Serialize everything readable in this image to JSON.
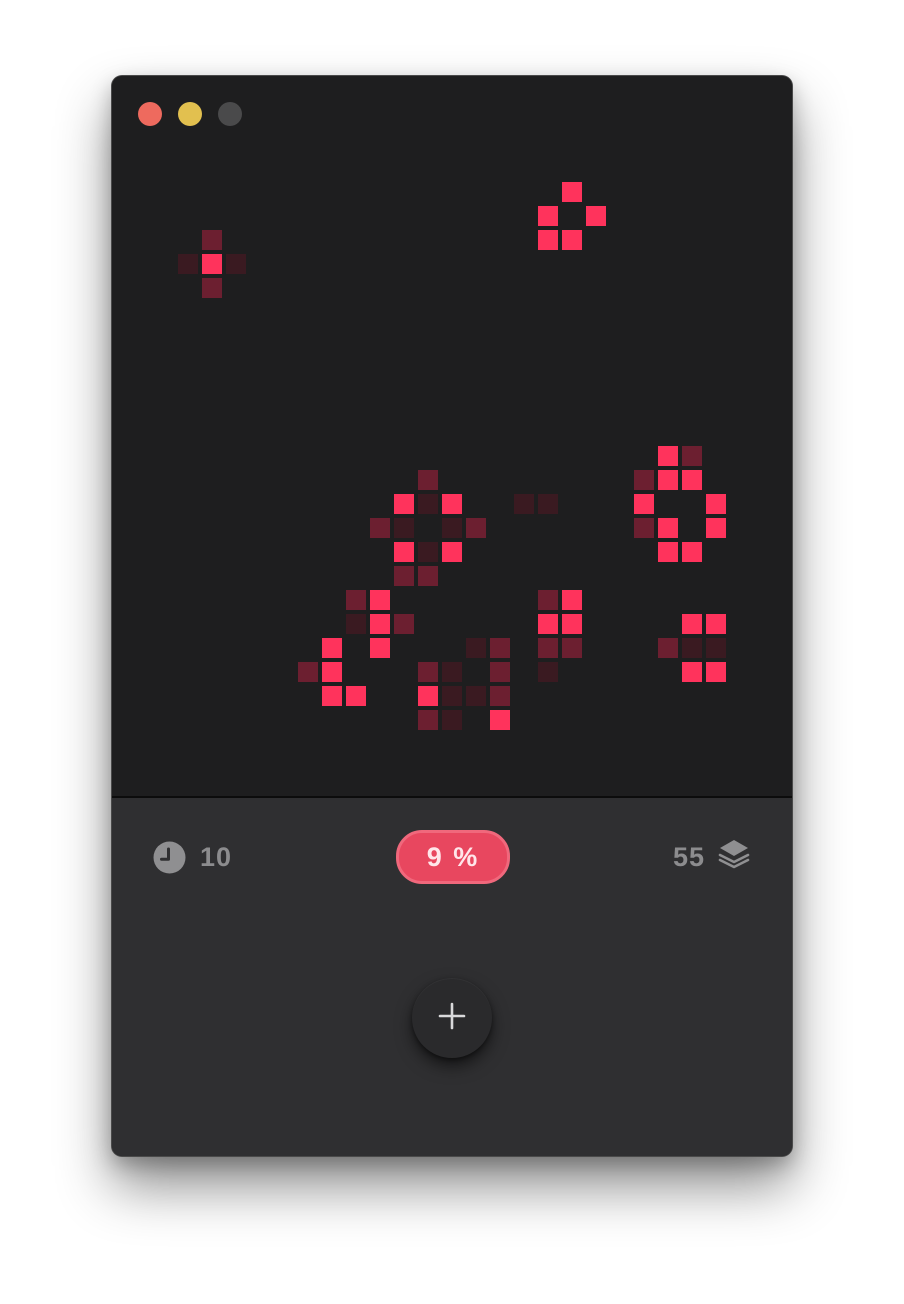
{
  "window": {
    "traffic_lights": [
      {
        "name": "close",
        "color": "#ee6a5e"
      },
      {
        "name": "minimize",
        "color": "#e2c04f"
      },
      {
        "name": "zoom-disabled",
        "color": "#4a4a4b"
      }
    ]
  },
  "board": {
    "cell_colors": {
      "alive": "#ff335c",
      "dying": "#6c1f30",
      "fading": "#3a1a21",
      "background": "#1e1e1f"
    },
    "cells": {
      "alive": [
        [
          19,
          4
        ],
        [
          18,
          5
        ],
        [
          20,
          5
        ],
        [
          18,
          6
        ],
        [
          19,
          6
        ],
        [
          4,
          7
        ],
        [
          23,
          15
        ],
        [
          23,
          16
        ],
        [
          24,
          16
        ],
        [
          12,
          17
        ],
        [
          14,
          17
        ],
        [
          22,
          17
        ],
        [
          25,
          17
        ],
        [
          23,
          18
        ],
        [
          25,
          18
        ],
        [
          12,
          19
        ],
        [
          14,
          19
        ],
        [
          23,
          19
        ],
        [
          24,
          19
        ],
        [
          11,
          21
        ],
        [
          19,
          21
        ],
        [
          11,
          22
        ],
        [
          18,
          22
        ],
        [
          19,
          22
        ],
        [
          24,
          22
        ],
        [
          25,
          22
        ],
        [
          9,
          23
        ],
        [
          11,
          23
        ],
        [
          9,
          24
        ],
        [
          9,
          25
        ],
        [
          10,
          25
        ],
        [
          13,
          25
        ],
        [
          16,
          26
        ],
        [
          24,
          24
        ],
        [
          25,
          24
        ]
      ],
      "dying": [
        [
          4,
          6
        ],
        [
          4,
          8
        ],
        [
          24,
          15
        ],
        [
          13,
          16
        ],
        [
          22,
          16
        ],
        [
          11,
          18
        ],
        [
          15,
          18
        ],
        [
          22,
          18
        ],
        [
          12,
          20
        ],
        [
          13,
          20
        ],
        [
          10,
          21
        ],
        [
          18,
          21
        ],
        [
          12,
          22
        ],
        [
          16,
          23
        ],
        [
          18,
          23
        ],
        [
          19,
          23
        ],
        [
          23,
          23
        ],
        [
          8,
          24
        ],
        [
          13,
          24
        ],
        [
          16,
          24
        ],
        [
          16,
          25
        ],
        [
          13,
          26
        ]
      ],
      "fading": [
        [
          3,
          7
        ],
        [
          5,
          7
        ],
        [
          13,
          17
        ],
        [
          17,
          17
        ],
        [
          18,
          17
        ],
        [
          12,
          18
        ],
        [
          14,
          18
        ],
        [
          13,
          19
        ],
        [
          10,
          22
        ],
        [
          15,
          23
        ],
        [
          14,
          24
        ],
        [
          18,
          24
        ],
        [
          24,
          23
        ],
        [
          25,
          23
        ],
        [
          14,
          25
        ],
        [
          15,
          25
        ],
        [
          14,
          26
        ]
      ]
    }
  },
  "status": {
    "generation_icon": "clock-icon",
    "generation_count": "10",
    "coverage_percent_label": "9 %",
    "coverage_percent": 9,
    "population_count": "55",
    "population_icon": "layers-icon",
    "accent_color": "#e8475f"
  },
  "actions": {
    "add_icon": "plus-icon",
    "add_label": "+"
  }
}
